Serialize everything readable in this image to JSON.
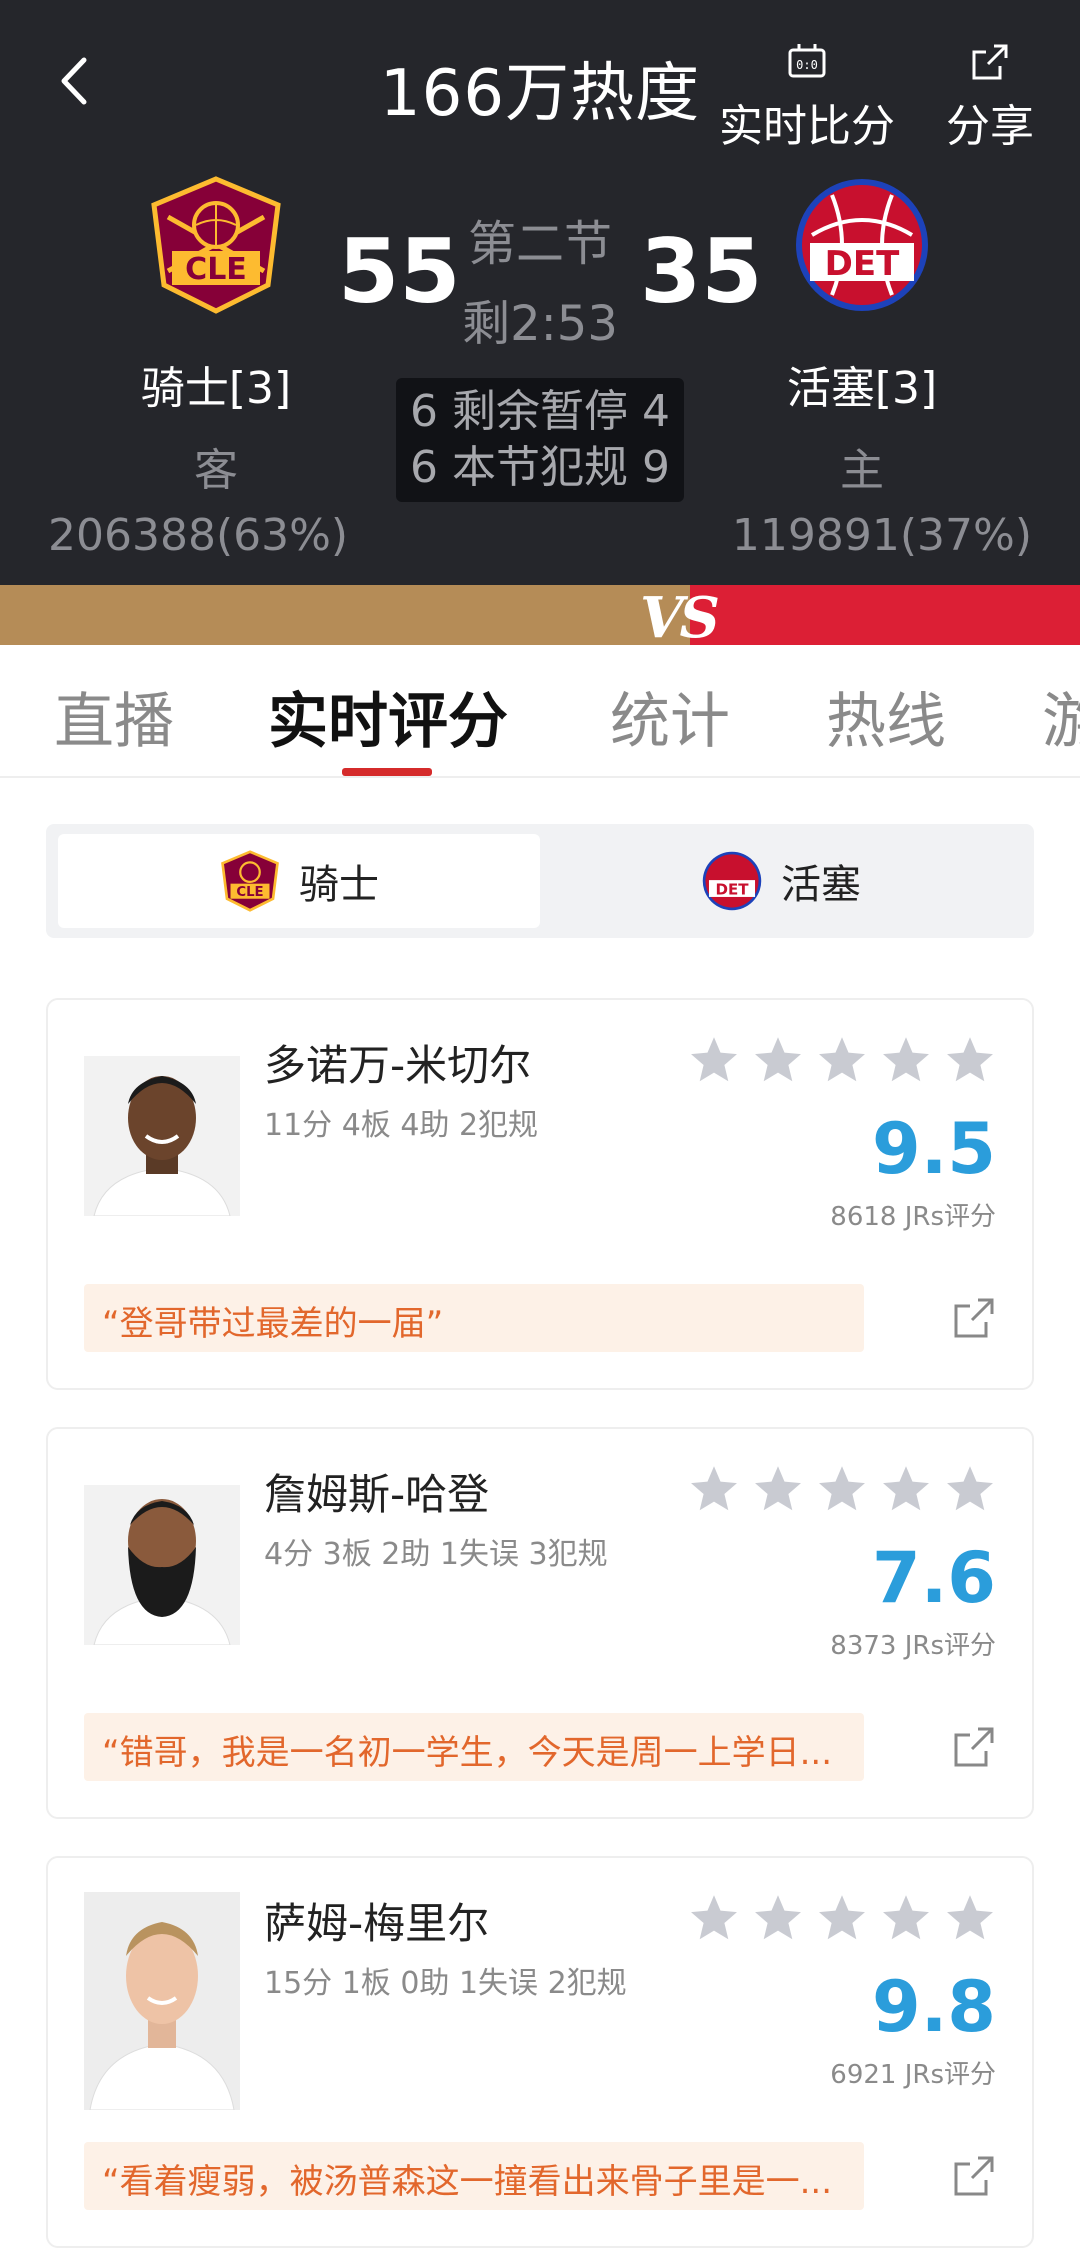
{
  "header": {
    "heat": "166万热度",
    "live_score_label": "实时比分",
    "share_label": "分享",
    "period": "第二节",
    "clock": "剩2:53",
    "timeouts_row": "6 剩余暂停 4",
    "fouls_row": "6 本节犯规 9",
    "away": {
      "name": "骑士[3]",
      "role": "客",
      "score": "55",
      "votes": "206388(63%)",
      "logo_text": "CLE",
      "color": "#860038",
      "accent": "#fdbb30"
    },
    "home": {
      "name": "活塞[3]",
      "role": "主",
      "score": "35",
      "votes": "119891(37%)",
      "logo_text": "DET",
      "color": "#c8102e",
      "accent": "#1d42ba"
    },
    "vs_label": "VS"
  },
  "tabs": [
    "直播",
    "实时评分",
    "统计",
    "热线",
    "游"
  ],
  "team_switch": {
    "left": "骑士",
    "right": "活塞",
    "left_logo_text": "CLE",
    "right_logo_text": "DET"
  },
  "players": [
    {
      "name": "多诺万-米切尔",
      "stats": "11分 4板 4助 2犯规",
      "score": "9.5",
      "votes": "8618 JRs评分",
      "comment": "“登哥带过最差的一届”"
    },
    {
      "name": "詹姆斯-哈登",
      "stats": "4分 3板 2助 1失误 3犯规",
      "score": "7.6",
      "votes": "8373 JRs评分",
      "comment": "“错哥，我是一名初一学生，今天是周一上学日..."
    },
    {
      "name": "萨姆-梅里尔",
      "stats": "15分 1板 0助 1失误 2犯规",
      "score": "9.8",
      "votes": "6921 JRs评分",
      "comment": "“看着瘦弱，被汤普森这一撞看出来骨子里是一..."
    }
  ],
  "colors": {
    "header_bg": "#25262b",
    "accent_red": "#d52b2b",
    "score_blue": "#2b9ddb",
    "comment_text": "#e2672c",
    "comment_bg": "#fdf1e7",
    "vs_gold": "#b58c57",
    "vs_red": "#dc1f35"
  },
  "icons": {
    "back": "chevron-left-icon",
    "live_score": "scoreboard-icon",
    "share": "share-icon",
    "star": "star-icon",
    "comment_share": "external-link-icon"
  }
}
